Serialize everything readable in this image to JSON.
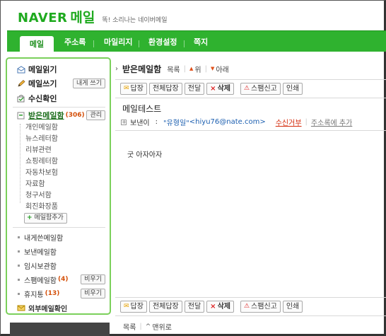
{
  "header": {
    "logo_naver": "NAVER",
    "logo_mail": "메일",
    "slogan": "똑! 소리나는 네이버메일"
  },
  "nav": {
    "tabs": [
      {
        "label": "메일",
        "active": true
      },
      {
        "label": "주소록"
      },
      {
        "label": "마일리지"
      },
      {
        "label": "환경설정"
      },
      {
        "label": "쪽지"
      }
    ]
  },
  "sidebar": {
    "read_mail": "메일읽기",
    "write_mail": "메일쓰기",
    "write_to_self": "내게 쓰기",
    "receipt_check": "수신확인",
    "inbox": {
      "label": "받은메일함",
      "count": "(306)",
      "manage": "관리"
    },
    "inbox_subfolders": [
      "개인메일함",
      "뉴스레터함",
      "리뷰관련",
      "쇼핑레터함",
      "자동차보험",
      "자료함",
      "청구서함",
      "회진화장품"
    ],
    "add_folder": "메일함추가",
    "folders": [
      {
        "label": "내게쓴메일함"
      },
      {
        "label": "보낸메일함"
      },
      {
        "label": "임시보관함"
      },
      {
        "label": "스팸메일함",
        "count": "(4)",
        "action": "비우기"
      },
      {
        "label": "휴지통",
        "count": "(13)",
        "action": "비우기"
      }
    ],
    "external": "외부메일확인"
  },
  "main": {
    "title": "받은메일함",
    "list_link": "목록",
    "prev_link": "위",
    "next_link": "아래",
    "toolbar": {
      "reply": "답장",
      "reply_all": "전체답장",
      "forward": "전달",
      "delete": "삭제",
      "spam": "스팸신고",
      "print": "인쇄"
    },
    "subject": "메일테스트",
    "sender_label": "보낸이",
    "sender_colon": ":",
    "sender_name": "\"유형일\"",
    "sender_email": "<hiyu76@nate.com>",
    "reject": "수신거부",
    "add_contact": "주소록에 추가",
    "body": "굿 아자아자",
    "bottom_list": "목록",
    "bottom_top": "맨위로"
  },
  "colors": {
    "brand_green": "#2fb22f",
    "sidebar_border": "#7bd05b",
    "count_orange": "#d4500a",
    "link_blue": "#1c5fb0",
    "reject_red": "#d42a0a"
  },
  "icons": {
    "read": "envelope-open-icon",
    "write": "pencil-icon",
    "receipt": "receipt-check-icon",
    "inbox": "inbox-box-icon",
    "external": "external-mail-icon"
  }
}
